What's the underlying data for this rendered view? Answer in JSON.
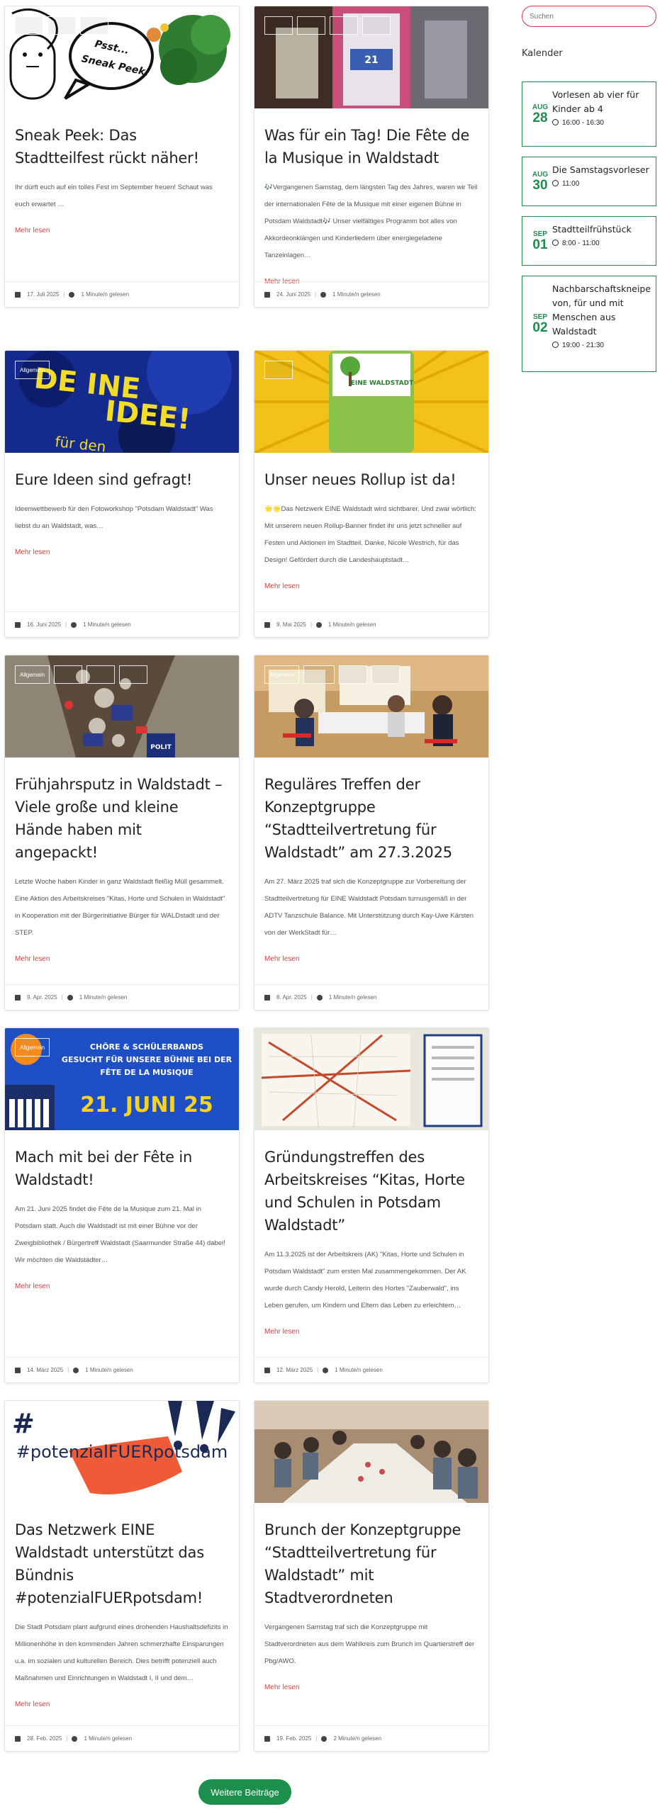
{
  "search": {
    "placeholder": "Suchen"
  },
  "sidebar": {
    "title": "Kalender",
    "events": [
      {
        "month": "AUG",
        "day": "28",
        "title": "Vorlesen ab vier für Kinder ab 4",
        "time": "16:00 - 16:30"
      },
      {
        "month": "AUG",
        "day": "30",
        "title": "Die Samstagsvorleser",
        "time": "11:00"
      },
      {
        "month": "SEP",
        "day": "01",
        "title": "Stadtteilfrühstück",
        "time": "8:00 - 11:00"
      },
      {
        "month": "SEP",
        "day": "02",
        "title": "Nachbarschaftskneipe von, für und mit Menschen aus Waldstadt",
        "time": "19:00 - 21:30"
      }
    ]
  },
  "posts": [
    {
      "title": "Sneak Peek: Das Stadtteilfest rückt näher!",
      "excerpt": "Ihr dürft euch auf ein tolles Fest im September freuen! Schaut was euch erwartet …",
      "more": "Mehr lesen",
      "date": "17. Juli 2025",
      "read": "1 Minute/n gelesen",
      "image_text": "Psst... Sneak Peek!"
    },
    {
      "title": "Was für ein Tag! Die Fête de la Musique in Waldstadt",
      "excerpt": "🎶Vergangenen Samstag, dem längsten Tag des Jahres, waren wir Teil der internationalen Fête de la Musique mit einer eigenen Bühne in Potsdam Waldstadt🎶 Unser vielfältiges Programm bot alles von Akkordeonklängen und Kinderliedern über energiegeladene Tanzeinlagen…",
      "more": "Mehr lesen",
      "date": "24. Juni 2025",
      "read": "1 Minute/n gelesen"
    },
    {
      "title": "Eure Ideen sind gefragt!",
      "excerpt": "Ideenwettbewerb für den Fotoworkshop \"Potsdam Waldstadt\" Was liebst du an Waldstadt, was…",
      "more": "Mehr lesen",
      "date": "16. Juni 2025",
      "read": "1 Minute/n gelesen",
      "category": "Allgemein"
    },
    {
      "title": "Unser neues Rollup ist da!",
      "excerpt": "🌟🌟Das Netzwerk EINE Waldstadt wird sichtbarer. Und zwar wörtlich: Mit unserem neuen Rollup-Banner findet ihr uns jetzt schneller auf Festen und Aktionen im Stadtteil.   Danke, Nicole Westrich, für das Design!   Gefördert durch die Landeshauptstadt…",
      "more": "Mehr lesen",
      "date": "9. Mai 2025",
      "read": "1 Minute/n gelesen",
      "image_text": "NETZWERK EINE WALDSTADT"
    },
    {
      "title": "Frühjahrsputz in Waldstadt – Viele große und kleine Hände haben mit angepackt!",
      "excerpt": "Letzte Woche haben Kinder in ganz Waldstadt fleißig Müll gesammelt. Eine Aktion des Arbeitskreises \"Kitas, Horte und Schulen in Waldstadt\" in Kooperation mit der Bürgerinitiative Bürger für WALDstadt und der STEP.",
      "more": "Mehr lesen",
      "date": "9. Apr. 2025",
      "read": "1 Minute/n gelesen",
      "category": "Allgemein"
    },
    {
      "title": "Reguläres Treffen der Konzeptgruppe “Stadtteilvertretung für Waldstadt” am 27.3.2025",
      "excerpt": "Am 27. März 2025 traf sich die Konzeptgruppe zur Vorbereitung der Stadtteilvertretung für EINE Waldstadt Potsdam turnusgemäß in der ADTV Tanzschule Balance. Mit Unterstützung durch Kay-Uwe Kärsten von der WerkStadt für…",
      "more": "Mehr lesen",
      "date": "8. Apr. 2025",
      "read": "1 Minute/n gelesen",
      "category": "Allgemein"
    },
    {
      "title": "Mach mit bei der Fête in Waldstadt!",
      "excerpt": "Am 21. Juni 2025 findet die Fête de la Musique zum 21. Mal in Potsdam statt. Auch die Waldstadt ist mit einer Bühne vor der Zweigbibliothek / Bürgertreff Waldstadt (Saarmunder Straße 44) dabei! Wir möchten die Waldstädter…",
      "more": "Mehr lesen",
      "date": "14. März 2025",
      "read": "1 Minute/n gelesen",
      "category": "Allgemein",
      "image_text": {
        "l1": "CHÖRE & SCHÜLERBANDS",
        "l2": "GESUCHT FÜR UNSERE BÜHNE BEI DER",
        "l3": "FÊTE DE LA MUSIQUE",
        "l4": "21. JUNI 25"
      }
    },
    {
      "title": "Gründungstreffen des Arbeitskreises “Kitas, Horte und Schulen in Potsdam Waldstadt”",
      "excerpt": "Am 11.3.2025 ist der Arbeitskreis (AK) \"Kitas, Horte und Schulen in Potsdam Waldstadt\" zum ersten Mal zusammengekommen. Der AK wurde durch Candy Herold, Leiterin des Hortes \"Zauberwald\", ins Leben gerufen, um Kindern und Eltern das Leben zu erleichtern…",
      "more": "Mehr lesen",
      "date": "12. März 2025",
      "read": "1 Minute/n gelesen"
    },
    {
      "title": "Das Netzwerk EINE Waldstadt unterstützt das Bündnis #potenzialFUERpotsdam!",
      "excerpt": "Die Stadt Potsdam plant aufgrund eines drohenden Haushaltsdefizits in Millionenhöhe in den kommenden Jahren schmerzhafte Einsparungen u.a. im sozialen und kulturellen Bereich. Dies betrifft potenziell auch Maßnahmen und Einrichtungen in Waldstadt I, II und dem…",
      "more": "Mehr lesen",
      "date": "28. Feb. 2025",
      "read": "1 Minute/n gelesen",
      "image_text": "#potenzialFUERpotsdam"
    },
    {
      "title": "Brunch der Konzeptgruppe “Stadtteilvertretung für Waldstadt” mit Stadtverordneten",
      "excerpt": "Vergangenen Samstag traf sich die Konzeptgruppe mit Stadtverordneten aus dem Wahlkreis zum Brunch im Quartierstreff der Pbg/AWO.",
      "more": "Mehr lesen",
      "date": "19. Feb. 2025",
      "read": "2 Minute/n gelesen"
    }
  ],
  "load_more": "Weitere Beiträge"
}
